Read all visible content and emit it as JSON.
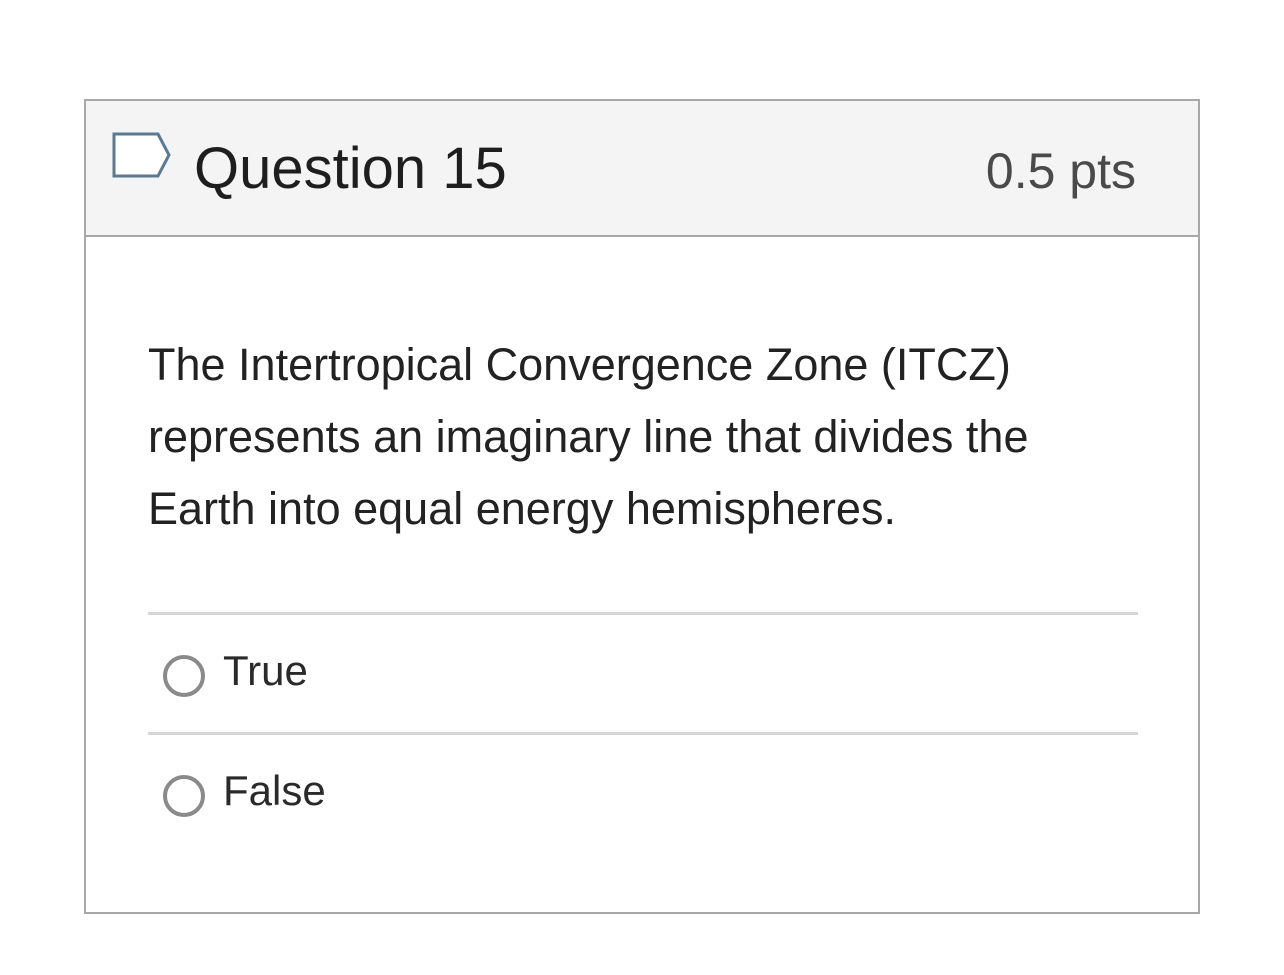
{
  "question": {
    "title": "Question 15",
    "points": "0.5 pts",
    "flag_icon": "flag-question-icon",
    "text": "The Intertropical Convergence Zone (ITCZ) represents an imaginary line that divides the Earth into equal energy hemispheres.",
    "answers": [
      {
        "label": "True",
        "selected": false
      },
      {
        "label": "False",
        "selected": false
      }
    ]
  },
  "colors": {
    "border": "#a8a8a8",
    "header_bg": "#f4f4f4",
    "flag_stroke": "#5a7a94",
    "radio_border": "#8a8a8a",
    "divider": "#d6d6d6"
  }
}
